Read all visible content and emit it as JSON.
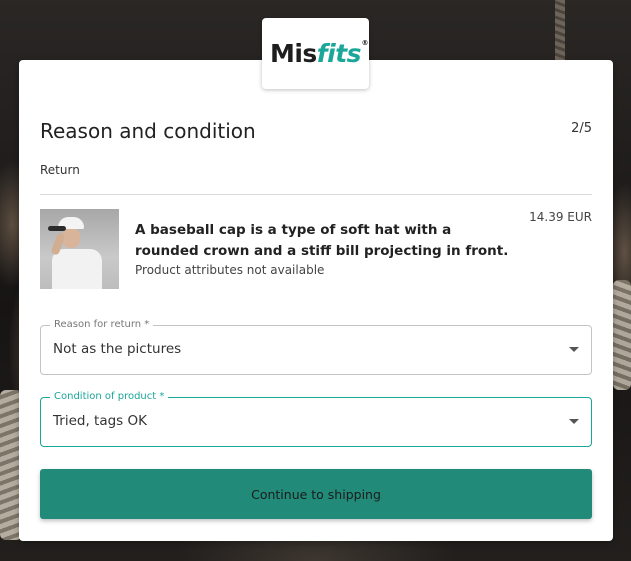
{
  "brand": {
    "logo_dark": "Mis",
    "logo_accent": "fits",
    "logo_reg": "®",
    "accent_color": "#1aa79a"
  },
  "header": {
    "title": "Reason and condition",
    "step": "2/5",
    "subtitle": "Return"
  },
  "product": {
    "title": "A baseball cap is a type of soft hat with a rounded crown and a stiff bill projecting in front.",
    "attributes": "Product attributes not available",
    "price": "14.39 EUR"
  },
  "reason_field": {
    "label": "Reason for return *",
    "value": "Not as the pictures"
  },
  "condition_field": {
    "label": "Condition of product *",
    "value": "Tried, tags OK"
  },
  "cta": {
    "label": "Continue to shipping",
    "color": "#218a79"
  }
}
